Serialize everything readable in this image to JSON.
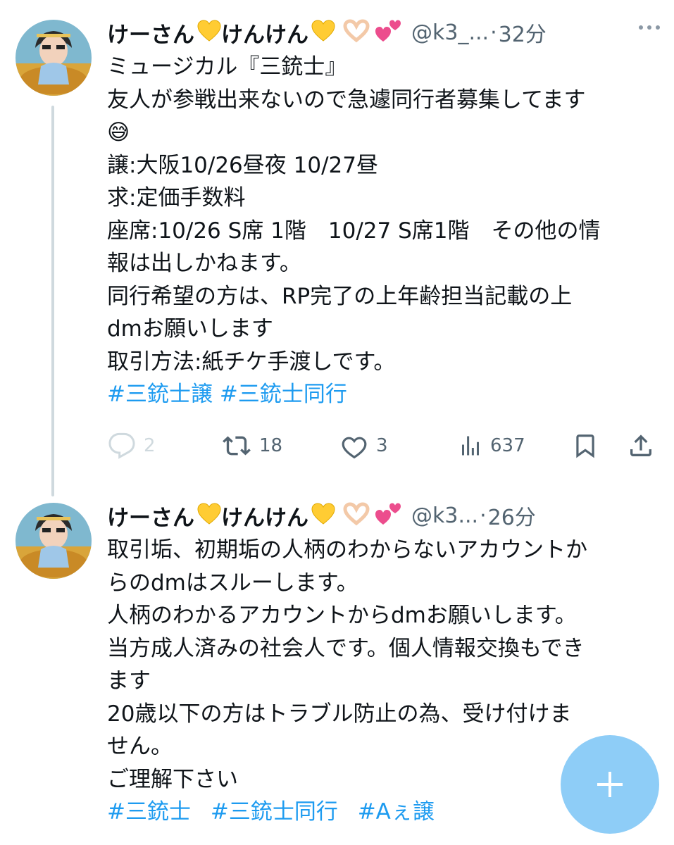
{
  "colors": {
    "link": "#1d9bf0",
    "muted": "#536471",
    "fab": "#8ecdf7",
    "thread_line": "#cfd9de"
  },
  "tweets": [
    {
      "author": {
        "name": "けーさん",
        "name_mid": "けんけん",
        "handle": "@k3_...",
        "avatar_icon": "avatar-anime-character"
      },
      "time": "32分",
      "lines": [
        "ミュージカル『三銃士』",
        "友人が参戦出来ないので急遽同行者募集してます",
        "😅",
        "譲:大阪10/26昼夜 10/27昼",
        "求:定価手数料",
        "座席:10/26 S席 1階　10/27 S席1階　その他の情",
        "報は出しかねます。",
        "同行希望の方は、RP完了の上年齢担当記載の上",
        "dmお願いします",
        "取引方法:紙チケ手渡しです。"
      ],
      "hashtags": [
        "#三銃士譲",
        "#三銃士同行"
      ],
      "stats": {
        "replies": "2",
        "retweets": "18",
        "likes": "3",
        "views": "637"
      }
    },
    {
      "author": {
        "name": "けーさん",
        "name_mid": "けんけん",
        "handle": "@k3...",
        "avatar_icon": "avatar-anime-character"
      },
      "time": "26分",
      "lines": [
        "取引垢、初期垢の人柄のわからないアカウントか",
        "らのdmはスルーします。",
        "人柄のわかるアカウントからdmお願いします。",
        "当方成人済みの社会人です。個人情報交換もでき",
        "ます",
        "20歳以下の方はトラブル防止の為、受け付けま",
        "せん。",
        "ご理解下さい"
      ],
      "hashtags": [
        "#三銃士",
        "#三銃士同行",
        "#Aぇ譲"
      ]
    }
  ],
  "icons": {
    "name_emojis": [
      "yellow-heart-icon",
      "yellow-heart-icon",
      "heart-hands-icon",
      "two-hearts-icon"
    ],
    "actions": [
      "reply-icon",
      "retweet-icon",
      "like-icon",
      "views-icon",
      "bookmark-icon",
      "share-icon"
    ],
    "fab": "plus-icon"
  }
}
